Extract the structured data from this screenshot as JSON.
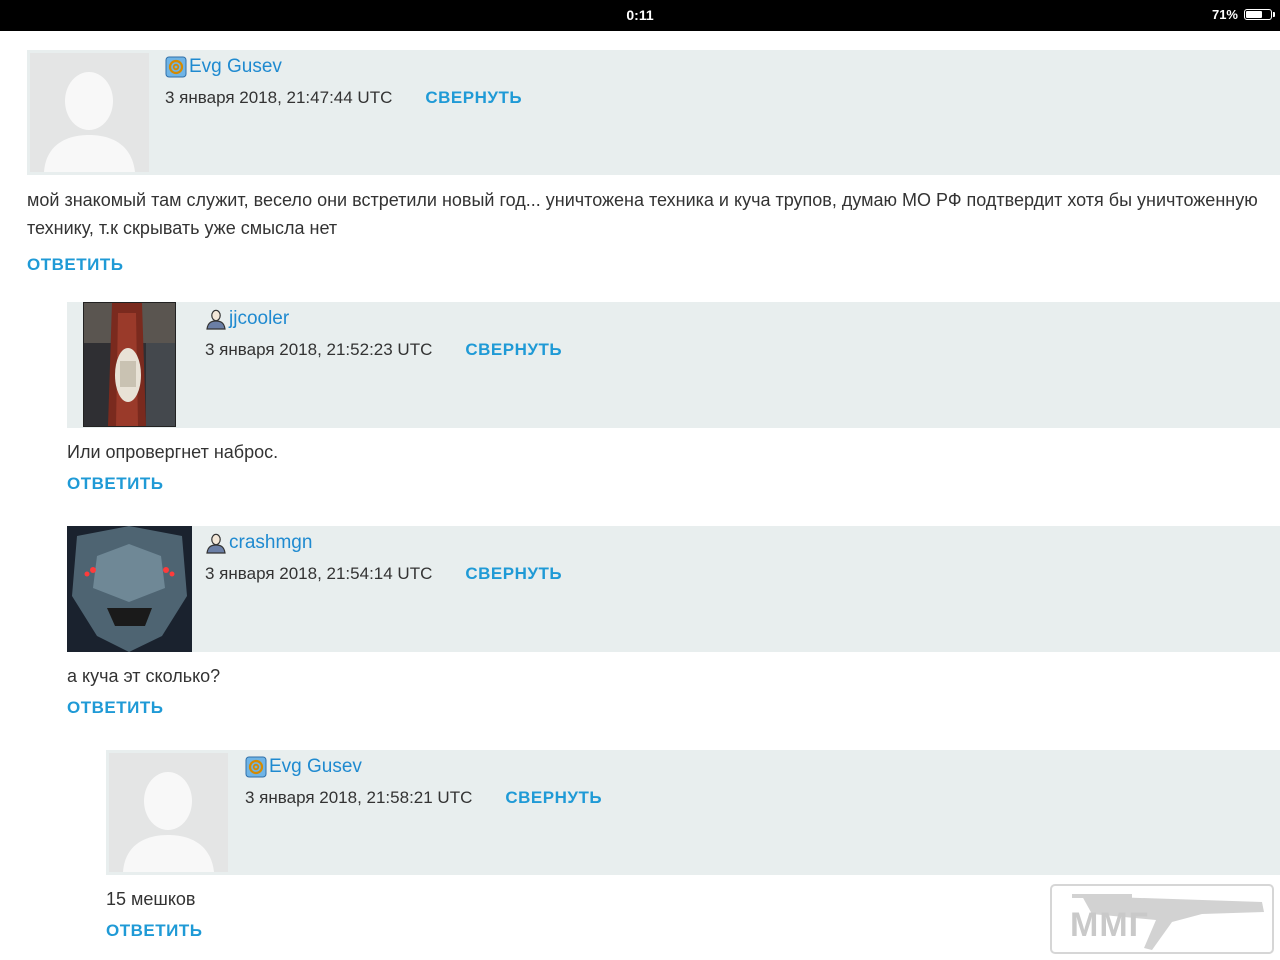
{
  "status_bar": {
    "time": "0:11",
    "battery": "71%",
    "battery_level": 0.71
  },
  "comments": [
    {
      "author": "Evg Gusev",
      "author_icon": "email-at-icon",
      "avatar": "default-silhouette",
      "date": "3 января 2018, 21:47:44 UTC",
      "collapse_label": "СВЕРНУТЬ",
      "text": "мой знакомый там служит, весело они встретили новый год... уничтожена техника и куча трупов, думаю МО РФ подтвердит хотя бы уничтоженную технику, т.к скрывать уже смысла нет",
      "reply_label": "ОТВЕТИТЬ"
    },
    {
      "author": "jjcooler",
      "author_icon": "user-icon",
      "avatar": "photo-sausage",
      "date": "3 января 2018, 21:52:23 UTC",
      "collapse_label": "СВЕРНУТЬ",
      "text": "Или опровергнет наброс.",
      "reply_label": "ОТВЕТИТЬ"
    },
    {
      "author": "crashmgn",
      "author_icon": "user-icon",
      "avatar": "photo-robot",
      "date": "3 января 2018, 21:54:14 UTC",
      "collapse_label": "СВЕРНУТЬ",
      "text": "а куча эт сколько?",
      "reply_label": "ОТВЕТИТЬ"
    },
    {
      "author": "Evg Gusev",
      "author_icon": "email-at-icon",
      "avatar": "default-silhouette",
      "date": "3 января 2018, 21:58:21 UTC",
      "collapse_label": "СВЕРНУТЬ",
      "text": "15 мешков",
      "reply_label": "ОТВЕТИТЬ"
    }
  ],
  "watermark": {
    "text": "ММГ"
  },
  "colors": {
    "link": "#1f9ad6",
    "header_bg": "#e8eeee",
    "status_bar": "#000000"
  }
}
